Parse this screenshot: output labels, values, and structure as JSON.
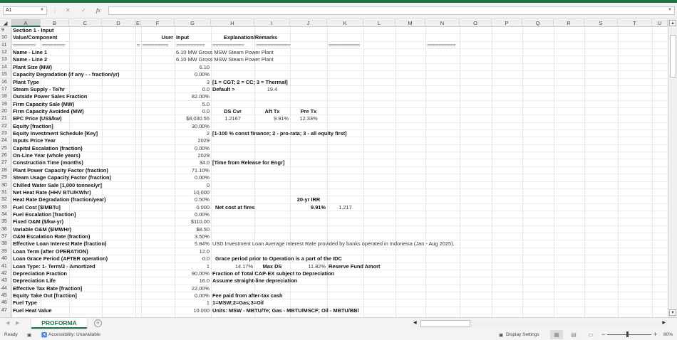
{
  "formula_bar": {
    "name_box": "A1",
    "cancel_icon": "✕",
    "enter_icon": "✓",
    "fx_label": "fx",
    "formula": ""
  },
  "columns": [
    "A",
    "B",
    "C",
    "D",
    "E",
    "F",
    "G",
    "H",
    "I",
    "J",
    "K",
    "L",
    "M",
    "N",
    "O",
    "P",
    "Q",
    "R",
    "S",
    "T",
    "U"
  ],
  "rows": [
    {
      "num": "9",
      "cells": [
        {
          "c": "A",
          "t": "Section 1 - Input",
          "b": true
        }
      ]
    },
    {
      "num": "10",
      "cells": [
        {
          "c": "A",
          "t": "Value/Component",
          "b": true
        },
        {
          "c": "F",
          "t": "User",
          "b": true,
          "align": "right"
        },
        {
          "c": "G",
          "t": "Input",
          "b": true
        },
        {
          "c": "H",
          "t": "Explanation/Remarks",
          "b": true,
          "align": "center-hi"
        }
      ]
    },
    {
      "num": "11",
      "cells": [
        {
          "c": "A",
          "t": "========",
          "eq": true
        },
        {
          "c": "B",
          "t": "========",
          "eq": true
        },
        {
          "c": "E",
          "t": "=",
          "eq": true
        },
        {
          "c": "F",
          "t": "=========",
          "eq": true
        },
        {
          "c": "G",
          "t": "==========",
          "eq": true
        },
        {
          "c": "H",
          "t": "===========",
          "eq": true
        },
        {
          "c": "I",
          "t": "============",
          "eq": true
        },
        {
          "c": "K",
          "t": "===========",
          "eq": true
        },
        {
          "c": "N",
          "t": "==========",
          "eq": true
        }
      ]
    },
    {
      "num": "12",
      "cells": [
        {
          "c": "A",
          "t": "Name - Line 1",
          "b": true
        },
        {
          "c": "G",
          "t": "6.10 MW Gross MSW Steam Power Plant"
        }
      ]
    },
    {
      "num": "13",
      "cells": [
        {
          "c": "A",
          "t": "Name - Line 2",
          "b": true
        },
        {
          "c": "G",
          "t": "6.10 MW Gross MSW Steam Power Plant"
        }
      ]
    },
    {
      "num": "14",
      "cells": [
        {
          "c": "A",
          "t": "Plant Size (MW)",
          "b": true
        },
        {
          "c": "G",
          "t": "6.10",
          "align": "right"
        }
      ]
    },
    {
      "num": "15",
      "cells": [
        {
          "c": "A",
          "t": "Capacity Degradation (if any - - fraction/yr)",
          "b": true
        },
        {
          "c": "G",
          "t": "0.00%",
          "align": "right"
        }
      ]
    },
    {
      "num": "16",
      "cells": [
        {
          "c": "A",
          "t": "Plant Type",
          "b": true
        },
        {
          "c": "G",
          "t": "3",
          "align": "right"
        },
        {
          "c": "H",
          "t": "[1 = CGT; 2 = CC; 3 = Thermal]",
          "b": true
        }
      ]
    },
    {
      "num": "17",
      "cells": [
        {
          "c": "A",
          "t": "Steam Supply - Te/hr",
          "b": true
        },
        {
          "c": "G",
          "t": "0.0",
          "align": "right"
        },
        {
          "c": "H",
          "t": "Default >",
          "b": true
        },
        {
          "c": "I",
          "t": "19.4",
          "align": "center"
        }
      ]
    },
    {
      "num": "18",
      "cells": [
        {
          "c": "A",
          "t": "Outside Power Sales Fraction",
          "b": true
        },
        {
          "c": "G",
          "t": "82.00%",
          "align": "right"
        }
      ]
    },
    {
      "num": "19",
      "cells": [
        {
          "c": "A",
          "t": "Firm Capacity Sale (MW)",
          "b": true
        },
        {
          "c": "G",
          "t": "5.0",
          "align": "right"
        }
      ]
    },
    {
      "num": "20",
      "cells": [
        {
          "c": "A",
          "t": "Firm Capacity Avoided (MW)",
          "b": true
        },
        {
          "c": "G",
          "t": "0.0",
          "align": "right"
        },
        {
          "c": "H",
          "t": "DS Cvr",
          "b": true,
          "align": "center"
        },
        {
          "c": "I",
          "t": "Aft Tx",
          "b": true,
          "align": "center"
        },
        {
          "c": "J",
          "t": "Pre Tx",
          "b": true,
          "align": "center"
        }
      ]
    },
    {
      "num": "21",
      "cells": [
        {
          "c": "A",
          "t": "EPC Price (US$/kw)",
          "b": true
        },
        {
          "c": "G",
          "t": "$8,030.55",
          "align": "right"
        },
        {
          "c": "H",
          "t": "1.2167",
          "align": "center"
        },
        {
          "c": "I",
          "t": "9.91%",
          "align": "right"
        },
        {
          "c": "J",
          "t": "12.33%",
          "align": "center"
        }
      ]
    },
    {
      "num": "22",
      "cells": [
        {
          "c": "A",
          "t": "Equity [fraction]",
          "b": true
        },
        {
          "c": "G",
          "t": "30.00%",
          "align": "right"
        }
      ]
    },
    {
      "num": "23",
      "cells": [
        {
          "c": "A",
          "t": "Equity Investment Schedule [Key]",
          "b": true
        },
        {
          "c": "G",
          "t": "2",
          "align": "right"
        },
        {
          "c": "H",
          "t": "[1-100 % const finance; 2 - pro-rata; 3 - all equity first]",
          "b": true
        }
      ]
    },
    {
      "num": "24",
      "cells": [
        {
          "c": "A",
          "t": "Inputs Price Year",
          "b": true
        },
        {
          "c": "G",
          "t": "2029",
          "align": "right"
        }
      ]
    },
    {
      "num": "25",
      "cells": [
        {
          "c": "A",
          "t": "Capital Escalation (fraction)",
          "b": true
        },
        {
          "c": "G",
          "t": "0.00%",
          "align": "right"
        }
      ]
    },
    {
      "num": "26",
      "cells": [
        {
          "c": "A",
          "t": "On-Line Year (whole years)",
          "b": true
        },
        {
          "c": "G",
          "t": "2029",
          "align": "right"
        }
      ]
    },
    {
      "num": "27",
      "cells": [
        {
          "c": "A",
          "t": "Construction Time (months)",
          "b": true
        },
        {
          "c": "G",
          "t": "34.0",
          "align": "right"
        },
        {
          "c": "H",
          "t": "[Time from Release for Engr]",
          "b": true
        }
      ]
    },
    {
      "num": "28",
      "cells": [
        {
          "c": "A",
          "t": "Plant Power Capacity Factor (fraction)",
          "b": true
        },
        {
          "c": "G",
          "t": "71.10%",
          "align": "right"
        }
      ]
    },
    {
      "num": "29",
      "cells": [
        {
          "c": "A",
          "t": "Steam Usage Capacity Factor (fraction)",
          "b": true
        },
        {
          "c": "G",
          "t": "0.00%",
          "align": "right"
        }
      ]
    },
    {
      "num": "30",
      "cells": [
        {
          "c": "A",
          "t": "Chilled Water Sale [1,000 tonnes/yr]",
          "b": true
        },
        {
          "c": "G",
          "t": "0",
          "align": "right"
        }
      ]
    },
    {
      "num": "31",
      "cells": [
        {
          "c": "A",
          "t": "Net Heat Rate (HHV BTU/KWhr)",
          "b": true
        },
        {
          "c": "G",
          "t": "10,000",
          "align": "right"
        }
      ]
    },
    {
      "num": "32",
      "cells": [
        {
          "c": "A",
          "t": "Heat Rate Degradation (fraction/year)",
          "b": true
        },
        {
          "c": "G",
          "t": "0.50%",
          "align": "right"
        },
        {
          "c": "J",
          "t": "20-yr IRR",
          "b": true,
          "align": "center"
        }
      ]
    },
    {
      "num": "33",
      "cells": [
        {
          "c": "A",
          "t": "Fuel Cost [$/MBTu]",
          "b": true
        },
        {
          "c": "G",
          "t": "0.000",
          "align": "right"
        },
        {
          "c": "H",
          "t": "Net cost at fires",
          "b": true,
          "indent": true
        },
        {
          "c": "J",
          "t": "9.91%",
          "b": true,
          "align": "right"
        },
        {
          "c": "K",
          "t": "1.217",
          "align": "center"
        }
      ]
    },
    {
      "num": "34",
      "cells": [
        {
          "c": "A",
          "t": "Fuel Escalation [fraction]",
          "b": true
        },
        {
          "c": "G",
          "t": "0.00%",
          "align": "right"
        }
      ]
    },
    {
      "num": "35",
      "cells": [
        {
          "c": "A",
          "t": "Fixed O&M ($/kw-yr)",
          "b": true
        },
        {
          "c": "G",
          "t": "$110.00",
          "align": "right"
        }
      ]
    },
    {
      "num": "36",
      "cells": [
        {
          "c": "A",
          "t": "Variable O&M ($/MWHr)",
          "b": true
        },
        {
          "c": "G",
          "t": "$8.50",
          "align": "right"
        }
      ]
    },
    {
      "num": "37",
      "cells": [
        {
          "c": "A",
          "t": "O&M Escalation Rate (fraction)",
          "b": true
        },
        {
          "c": "G",
          "t": "3.50%",
          "align": "right"
        }
      ]
    },
    {
      "num": "38",
      "cells": [
        {
          "c": "A",
          "t": "Effective Loan Interest Rate (fraction)",
          "b": true
        },
        {
          "c": "G",
          "t": "5.84%",
          "align": "right"
        },
        {
          "c": "H",
          "t": "USD Investment Loan Average Interest Rate provided by banks operated in Indonesia (Jan - Aug 2025)."
        }
      ]
    },
    {
      "num": "39",
      "cells": [
        {
          "c": "A",
          "t": "Loan Term (after  OPERATION)",
          "b": true
        },
        {
          "c": "G",
          "t": "12.0",
          "align": "right"
        }
      ]
    },
    {
      "num": "40",
      "cells": [
        {
          "c": "A",
          "t": "Loan Grace Period (AFTER operation)",
          "b": true
        },
        {
          "c": "G",
          "t": "0.0",
          "align": "right"
        },
        {
          "c": "H",
          "t": "Grace period prior to Operation is a part of the IDC",
          "b": true,
          "indent": true
        }
      ]
    },
    {
      "num": "41",
      "cells": [
        {
          "c": "A",
          "t": "Loan Type: 1- Term/2 - Amortized",
          "b": true
        },
        {
          "c": "G",
          "t": "1",
          "align": "right"
        },
        {
          "c": "H",
          "t": "14.17%",
          "align": "right"
        },
        {
          "c": "I",
          "t": "Max DS",
          "b": true,
          "align": "center"
        },
        {
          "c": "J",
          "t": "11.82%",
          "align": "right"
        },
        {
          "c": "K",
          "t": "Reserve Fund Amort",
          "b": true
        }
      ]
    },
    {
      "num": "42",
      "cells": [
        {
          "c": "A",
          "t": "Depreciation Fraction",
          "b": true
        },
        {
          "c": "G",
          "t": "90.00%",
          "align": "right"
        },
        {
          "c": "H",
          "t": "Fraction of  Total CAP-EX  subject to Depreciation",
          "b": true
        }
      ]
    },
    {
      "num": "43",
      "cells": [
        {
          "c": "A",
          "t": "Depreciation Life",
          "b": true
        },
        {
          "c": "G",
          "t": "16.0",
          "align": "right"
        },
        {
          "c": "H",
          "t": "Assume straight-line depreciation",
          "b": true
        }
      ]
    },
    {
      "num": "44",
      "cells": [
        {
          "c": "A",
          "t": "Effective Tax Rate [fraction]",
          "b": true
        },
        {
          "c": "G",
          "t": "22.00%",
          "align": "right"
        }
      ]
    },
    {
      "num": "45",
      "cells": [
        {
          "c": "A",
          "t": "Equity Take Out [fraction]",
          "b": true
        },
        {
          "c": "G",
          "t": "0.00%",
          "align": "right"
        },
        {
          "c": "H",
          "t": "Fee paid from after-tax cash",
          "b": true
        }
      ]
    },
    {
      "num": "46",
      "cells": [
        {
          "c": "A",
          "t": "Fuel Type",
          "b": true
        },
        {
          "c": "G",
          "t": "1",
          "align": "right"
        },
        {
          "c": "H",
          "t": "1=MSW;2=Gas;3=Oil",
          "b": true
        }
      ]
    },
    {
      "num": "47",
      "cells": [
        {
          "c": "A",
          "t": "Fuel Heat Value",
          "b": true
        },
        {
          "c": "G",
          "t": "10.000",
          "align": "right"
        },
        {
          "c": "H",
          "t": "Units: MSW - MBTU/Te; Gas - MBTU/MSCF; Oil - MBTU/BBl",
          "b": true
        }
      ]
    }
  ],
  "sheet_tabs": [
    {
      "label": "PROFORMA",
      "active": true
    }
  ],
  "add_sheet_label": "+",
  "status_bar": {
    "ready": "Ready",
    "accessibility": "Accessibility: Unavailable",
    "display_settings": "Display Settings",
    "zoom": "80%",
    "zoom_minus": "−",
    "zoom_plus": "+"
  },
  "colors": {
    "accent": "#217346"
  }
}
